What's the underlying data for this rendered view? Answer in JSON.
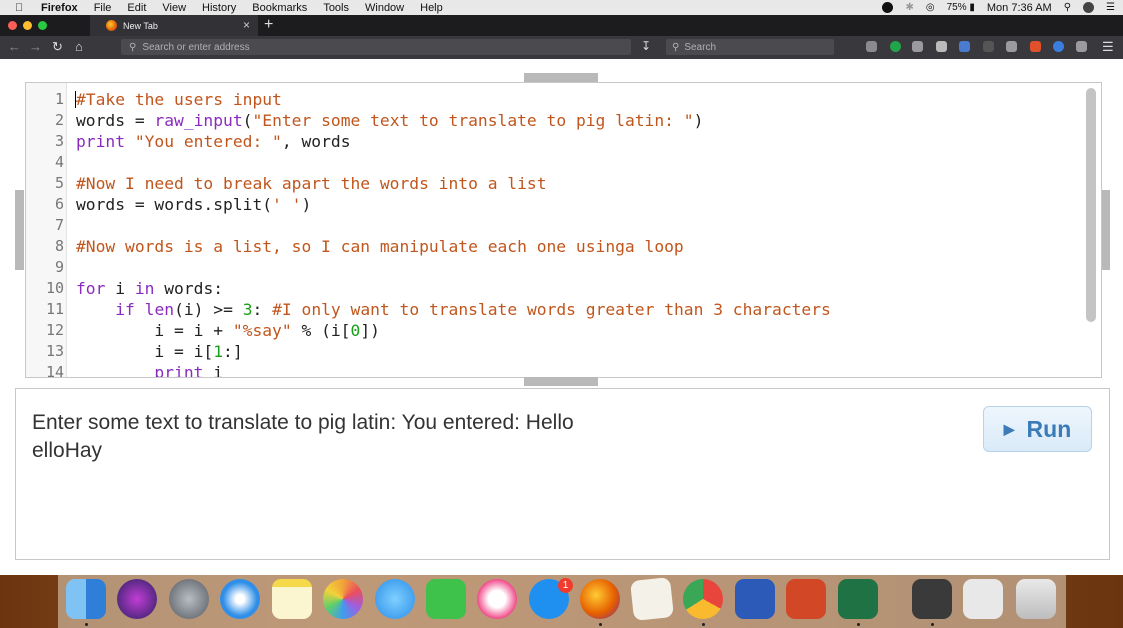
{
  "menubar": {
    "app_name": "Firefox",
    "items": [
      "File",
      "Edit",
      "View",
      "History",
      "Bookmarks",
      "Tools",
      "Window",
      "Help"
    ],
    "battery": "75%",
    "clock": "Mon 7:36 AM"
  },
  "browser": {
    "tab_title": "New Tab",
    "url_placeholder": "Search or enter address",
    "search_placeholder": "Search"
  },
  "editor": {
    "lines": [
      {
        "n": "1",
        "tokens": [
          [
            "comment",
            "#Take the users input"
          ]
        ]
      },
      {
        "n": "2",
        "tokens": [
          [
            "plain",
            "words = "
          ],
          [
            "builtin",
            "raw_input"
          ],
          [
            "plain",
            "("
          ],
          [
            "string",
            "\"Enter some text to translate to pig latin: \""
          ],
          [
            "plain",
            ")"
          ]
        ]
      },
      {
        "n": "3",
        "tokens": [
          [
            "keyword",
            "print"
          ],
          [
            "plain",
            " "
          ],
          [
            "string",
            "\"You entered: \""
          ],
          [
            "plain",
            ", words"
          ]
        ]
      },
      {
        "n": "4",
        "tokens": []
      },
      {
        "n": "5",
        "tokens": [
          [
            "comment",
            "#Now I need to break apart the words into a list"
          ]
        ]
      },
      {
        "n": "6",
        "tokens": [
          [
            "plain",
            "words = words.split("
          ],
          [
            "string",
            "' '"
          ],
          [
            "plain",
            ")"
          ]
        ]
      },
      {
        "n": "7",
        "tokens": []
      },
      {
        "n": "8",
        "tokens": [
          [
            "comment",
            "#Now words is a list, so I can manipulate each one usinga loop"
          ]
        ]
      },
      {
        "n": "9",
        "tokens": []
      },
      {
        "n": "10",
        "tokens": [
          [
            "keyword",
            "for"
          ],
          [
            "plain",
            " i "
          ],
          [
            "keyword",
            "in"
          ],
          [
            "plain",
            " words:"
          ]
        ]
      },
      {
        "n": "11",
        "tokens": [
          [
            "plain",
            "    "
          ],
          [
            "keyword",
            "if"
          ],
          [
            "plain",
            " "
          ],
          [
            "builtin",
            "len"
          ],
          [
            "plain",
            "(i) >= "
          ],
          [
            "number",
            "3"
          ],
          [
            "plain",
            ": "
          ],
          [
            "comment",
            "#I only want to translate words greater than 3 characters"
          ]
        ]
      },
      {
        "n": "12",
        "tokens": [
          [
            "plain",
            "        i = i + "
          ],
          [
            "string",
            "\"%say\""
          ],
          [
            "plain",
            " % (i["
          ],
          [
            "number",
            "0"
          ],
          [
            "plain",
            "])"
          ]
        ]
      },
      {
        "n": "13",
        "tokens": [
          [
            "plain",
            "        i = i["
          ],
          [
            "number",
            "1"
          ],
          [
            "plain",
            ":]"
          ]
        ]
      },
      {
        "n": "14",
        "tokens": [
          [
            "plain",
            "        "
          ],
          [
            "keyword",
            "print"
          ],
          [
            "plain",
            " i"
          ]
        ]
      }
    ]
  },
  "output": {
    "text": "Enter some text to translate to pig latin: You entered:  Hello\nelloHay",
    "run_label": "Run"
  },
  "dock": {
    "apps": [
      "finder-icon",
      "siri-icon",
      "launchpad-icon",
      "safari-icon",
      "notes-icon",
      "photos-icon",
      "messages-icon",
      "facetime-icon",
      "itunes-icon",
      "app-store-icon",
      "firefox-icon",
      "textedit-icon",
      "chrome-icon",
      "word-icon",
      "powerpoint-icon",
      "excel-icon",
      "preview-icon",
      "printer-icon",
      "trash-icon"
    ],
    "app_store_badge": "1"
  }
}
